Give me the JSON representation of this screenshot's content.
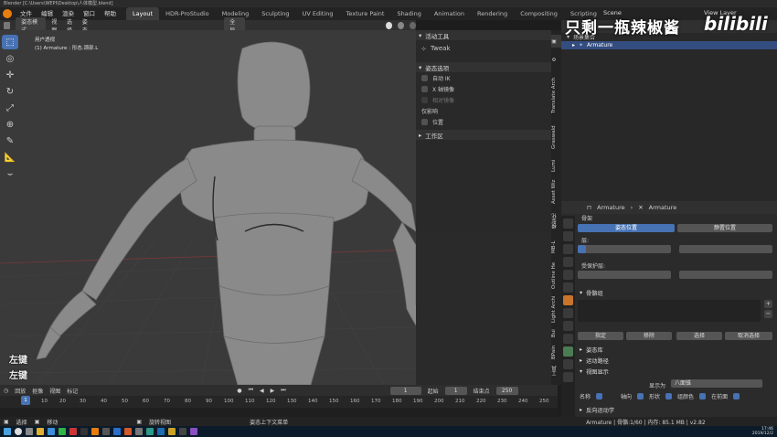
{
  "window": {
    "title": "Blender [C:\\Users\\WEPI\\Desktop\\人体模型.blend]"
  },
  "menu": [
    "文件",
    "编辑",
    "渲染",
    "窗口",
    "帮助"
  ],
  "workspaces": [
    "Layout",
    "HDR-ProStudio",
    "Modeling",
    "Sculpting",
    "UV Editing",
    "Texture Paint",
    "Shading",
    "Animation",
    "Rendering",
    "Compositing",
    "Scripting"
  ],
  "scene": {
    "label": "Scene",
    "view_layer": "View Layer"
  },
  "viewport_header": {
    "mode": "姿态模式",
    "items": [
      "视图",
      "选择",
      "姿态"
    ],
    "orientation": "全局"
  },
  "viewport": {
    "view_name": "用户透视",
    "object_info": "(1) Armature : 形态.颈部.L",
    "key_hint_1": "左键",
    "key_hint_2": "左键"
  },
  "npanel": {
    "active_tool_title": "活动工具",
    "tool_name": "Tweak",
    "pose_options_title": "姿态选项",
    "auto_ik": "自动 IK",
    "x_mirror": "X 轴镜像",
    "relative_mirror": "相对镜像",
    "affect_only": "仅影响",
    "locations": "位置",
    "workspace_title": "工作区"
  },
  "vertical_tabs": [
    "Translate Arch",
    "Graswald",
    "Lumi",
    "Asset Wiz",
    "模型化",
    "MB-L",
    "Outline He",
    "Light Archi",
    "Bui",
    "BPain",
    "工具"
  ],
  "outliner": {
    "header": "场景集合",
    "item": "Armature"
  },
  "properties": {
    "breadcrumb_1": "Armature",
    "breadcrumb_2": "Armature",
    "skeleton_label": "骨架",
    "pose_position": "姿态位置",
    "rest_position": "静置位置",
    "layers_label": "层:",
    "protected_label": "受保护层:",
    "bone_groups": "骨骼组",
    "assign": "指定",
    "remove": "移除",
    "select": "选择",
    "deselect": "取消选择",
    "pose_library": "姿态库",
    "motion_paths": "运动路径",
    "viewport_display": "视图显示",
    "display_as_label": "显示为",
    "display_as_value": "八面锥",
    "names": "名称",
    "axes": "轴向",
    "shapes": "形状",
    "group_colors": "组颜色",
    "in_front": "在前面",
    "inverse_kinematics": "反向运动学"
  },
  "timeline": {
    "items": [
      "回放",
      "抠像",
      "视图",
      "标记"
    ],
    "current_frame": "1",
    "start_label": "起始",
    "start": "1",
    "end_label": "结束点",
    "end": "250",
    "ticks": [
      "1",
      "10",
      "20",
      "30",
      "40",
      "50",
      "60",
      "70",
      "80",
      "90",
      "100",
      "110",
      "120",
      "130",
      "140",
      "150",
      "160",
      "170",
      "180",
      "190",
      "200",
      "210",
      "220",
      "230",
      "240",
      "250"
    ]
  },
  "statusbar": {
    "select": "选择",
    "move": "移动",
    "rotate_view": "旋转视图",
    "context_menu": "姿态上下文菜单",
    "stats": "Armature | 骨骼:1/60 | 内存: 85.1 MB | v2.82"
  },
  "taskbar": {
    "clock": "17:46",
    "date": "2019/12/2"
  },
  "watermark": {
    "text": "只剩一瓶辣椒酱",
    "brand": "bilibili"
  }
}
